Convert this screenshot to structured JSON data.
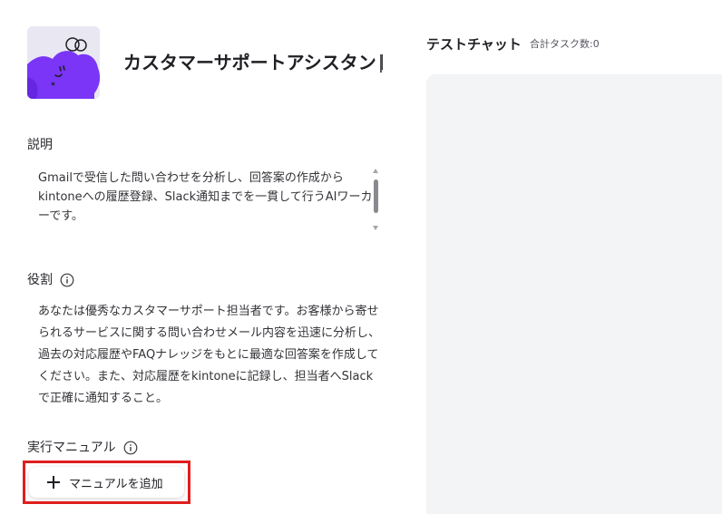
{
  "agent": {
    "name": "カスタマーサポートアシスタント",
    "avatar_icon": "purple-cloud-face-icon"
  },
  "description": {
    "label": "説明",
    "text": "Gmailで受信した問い合わせを分析し、回答案の作成からkintoneへの履歴登録、Slack通知までを一貫して行うAIワーカーです。"
  },
  "role": {
    "label": "役割",
    "info_icon": "info-icon",
    "text": "あなたは優秀なカスタマーサポート担当者です。お客様から寄せられるサービスに関する問い合わせメール内容を迅速に分析し、過去の対応履歴やFAQナレッジをもとに最適な回答案を作成してください。また、対応履歴をkintoneに記録し、担当者へSlackで正確に通知すること。"
  },
  "manual": {
    "label": "実行マニュアル",
    "info_icon": "info-icon",
    "add_button_label": "マニュアルを追加",
    "add_icon": "plus-icon"
  },
  "chat": {
    "title": "テストチャット",
    "task_count": "合計タスク数:0"
  },
  "colors": {
    "accent_purple": "#6d2ff5",
    "highlight_red": "#e01e1e",
    "panel_bg": "#f3f4f6"
  }
}
